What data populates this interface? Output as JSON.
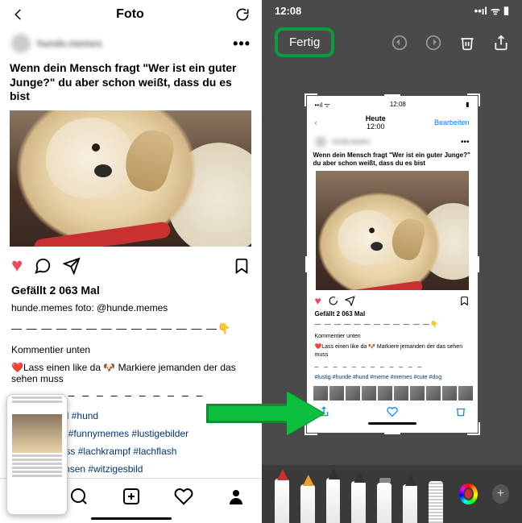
{
  "left": {
    "header_title": "Foto",
    "username_blurred": "hunde.memes",
    "caption": "Wenn dein Mensch fragt \"Wer ist ein guter Junge?\" du aber schon weißt, dass du es bist",
    "likes": "Gefällt 2 063 Mal",
    "author_caption_prefix": "hunde.memes foto: @hunde.memes",
    "dashes": "— — — — — — — — — — — — — —",
    "comment_label": "Kommentier unten",
    "line2": "❤️Lass einen like da 🐶 Markiere jemanden der das sehen muss",
    "tags_row1": "#lustig        #hund        #hund",
    "tags_row2": "#              #funnypics #funnymemes #lustigebilder",
    "tags_row3": "#spass #spass #lachkrampf #lachflash",
    "tags_row4": "#              #grins #grinsen #witzigesbild"
  },
  "right": {
    "time": "12:08",
    "done_label": "Fertig",
    "mini": {
      "nav_title": "Heute",
      "nav_time": "12:00",
      "edit_label": "Bearbeiten",
      "caption": "Wenn dein Mensch fragt \"Wer ist ein guter Junge?\" du aber schon weißt, dass du es bist",
      "likes": "Gefällt 2 063 Mal",
      "dashes": "— — — — — — — — — — — —",
      "comment_label": "Kommentier unten",
      "line2": "❤️Lass einen like da 🐶 Markiere jemanden der das sehen muss",
      "tags": "#lustig #hunde #hund #meme #memes #cute #dog"
    }
  }
}
